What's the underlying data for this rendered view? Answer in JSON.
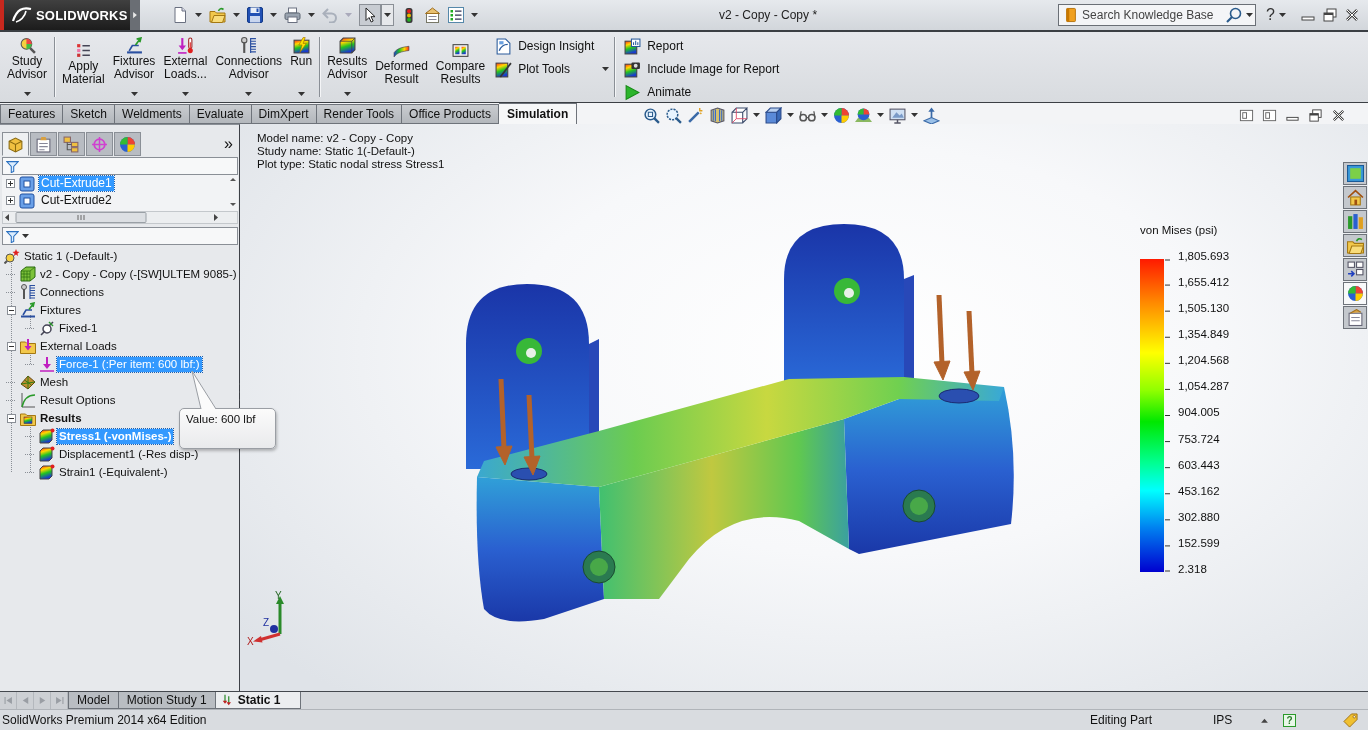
{
  "title_bar": {
    "logo": "SOLIDWORKS",
    "title": "v2 - Copy - Copy *",
    "search": {
      "placeholder": "Search Knowledge Base"
    },
    "help": "?"
  },
  "ribbon": {
    "sections": [
      {
        "items": [
          {
            "label": "Study Advisor",
            "kind": "large",
            "dropdown": true
          }
        ]
      },
      {
        "items": [
          {
            "label": "Apply Material",
            "kind": "large",
            "dropdown": false
          },
          {
            "label": "Fixtures Advisor",
            "kind": "large",
            "dropdown": true
          },
          {
            "label": "External Loads...",
            "kind": "large",
            "dropdown": true
          },
          {
            "label": "Connections Advisor",
            "kind": "large",
            "dropdown": true
          },
          {
            "label": "Run",
            "kind": "large",
            "dropdown": true
          }
        ]
      },
      {
        "items": [
          {
            "label": "Results Advisor",
            "kind": "large",
            "dropdown": true
          },
          {
            "label": "Deformed Result",
            "kind": "large",
            "dropdown": false
          },
          {
            "label": "Compare Results",
            "kind": "large",
            "dropdown": false
          },
          {
            "label": "Design Insight",
            "kind": "small",
            "dropdown": false
          },
          {
            "label": "Plot Tools",
            "kind": "small",
            "dropdown": true
          }
        ]
      },
      {
        "items": [
          {
            "label": "Report",
            "kind": "small",
            "dropdown": false
          },
          {
            "label": "Include Image for Report",
            "kind": "small",
            "dropdown": false
          },
          {
            "label": "Animate",
            "kind": "small",
            "dropdown": false
          }
        ]
      }
    ]
  },
  "command_tabs": [
    {
      "label": "Features",
      "selected": false
    },
    {
      "label": "Sketch",
      "selected": false
    },
    {
      "label": "Weldments",
      "selected": false
    },
    {
      "label": "Evaluate",
      "selected": false
    },
    {
      "label": "DimXpert",
      "selected": false
    },
    {
      "label": "Render Tools",
      "selected": false
    },
    {
      "label": "Office Products",
      "selected": false
    },
    {
      "label": "Simulation",
      "selected": true
    }
  ],
  "feature_manager": {
    "tabs": [
      {
        "selected": true
      },
      {
        "selected": false
      },
      {
        "selected": false
      },
      {
        "selected": false
      },
      {
        "selected": false
      }
    ],
    "overflow": "»",
    "tree": [
      {
        "label": "Cut-Extrude1",
        "selected": true,
        "expanded": false
      },
      {
        "label": "Cut-Extrude2",
        "selected": false,
        "expanded": false
      }
    ]
  },
  "simulation_tree": {
    "root": {
      "label": "Static 1 (-Default-)",
      "kind": "study",
      "selected": false,
      "children": [
        {
          "label": "v2 - Copy - Copy (-[SW]ULTEM 9085-)",
          "kind": "part",
          "selected": false
        },
        {
          "label": "Connections",
          "kind": "connections",
          "selected": false
        },
        {
          "label": "Fixtures",
          "kind": "fixtures",
          "selected": false,
          "expanded": true,
          "children": [
            {
              "label": "Fixed-1",
              "kind": "fixture",
              "selected": false
            }
          ]
        },
        {
          "label": "External Loads",
          "kind": "loads",
          "selected": false,
          "expanded": true,
          "children": [
            {
              "label": "Force-1 (:Per item: 600 lbf:)",
              "kind": "force",
              "selected": true
            }
          ]
        },
        {
          "label": "Mesh",
          "kind": "mesh",
          "selected": false
        },
        {
          "label": "Result Options",
          "kind": "options",
          "selected": false
        },
        {
          "label": "Results",
          "kind": "results",
          "selected": false,
          "expanded": true,
          "children": [
            {
              "label": "Stress1 (-vonMises-)",
              "kind": "plot",
              "selected": true,
              "active": true
            },
            {
              "label": "Displacement1 (-Res disp-)",
              "kind": "plot",
              "selected": false,
              "active": false
            },
            {
              "label": "Strain1 (-Equivalent-)",
              "kind": "plot",
              "selected": false,
              "active": false
            }
          ]
        }
      ]
    }
  },
  "tooltip": "Value: 600 lbf",
  "viewport": {
    "model_info": [
      "Model name: v2 - Copy - Copy",
      "Study name: Static 1(-Default-)",
      "Plot type: Static nodal stress Stress1"
    ],
    "legend": {
      "title": "von Mises (psi)",
      "labels": [
        "1,805.693",
        "1,655.412",
        "1,505.130",
        "1,354.849",
        "1,204.568",
        "1,054.287",
        "904.005",
        "753.724",
        "603.443",
        "453.162",
        "302.880",
        "152.599",
        "2.318"
      ]
    },
    "axis_labels": {
      "y": "Y",
      "z": "Z",
      "x": "X"
    },
    "task_pane_tabs": [
      {
        "selected": false
      },
      {
        "selected": false
      },
      {
        "selected": false
      },
      {
        "selected": false
      },
      {
        "selected": false
      },
      {
        "selected": true
      },
      {
        "selected": false
      }
    ]
  },
  "bottom_tabs": [
    {
      "label": "Model",
      "selected": false
    },
    {
      "label": "Motion Study 1",
      "selected": false
    },
    {
      "label": "Static 1",
      "selected": true
    }
  ],
  "status_bar": {
    "edition": "SolidWorks Premium 2014 x64 Edition",
    "mode": "Editing Part",
    "units": "IPS",
    "help": "?"
  }
}
